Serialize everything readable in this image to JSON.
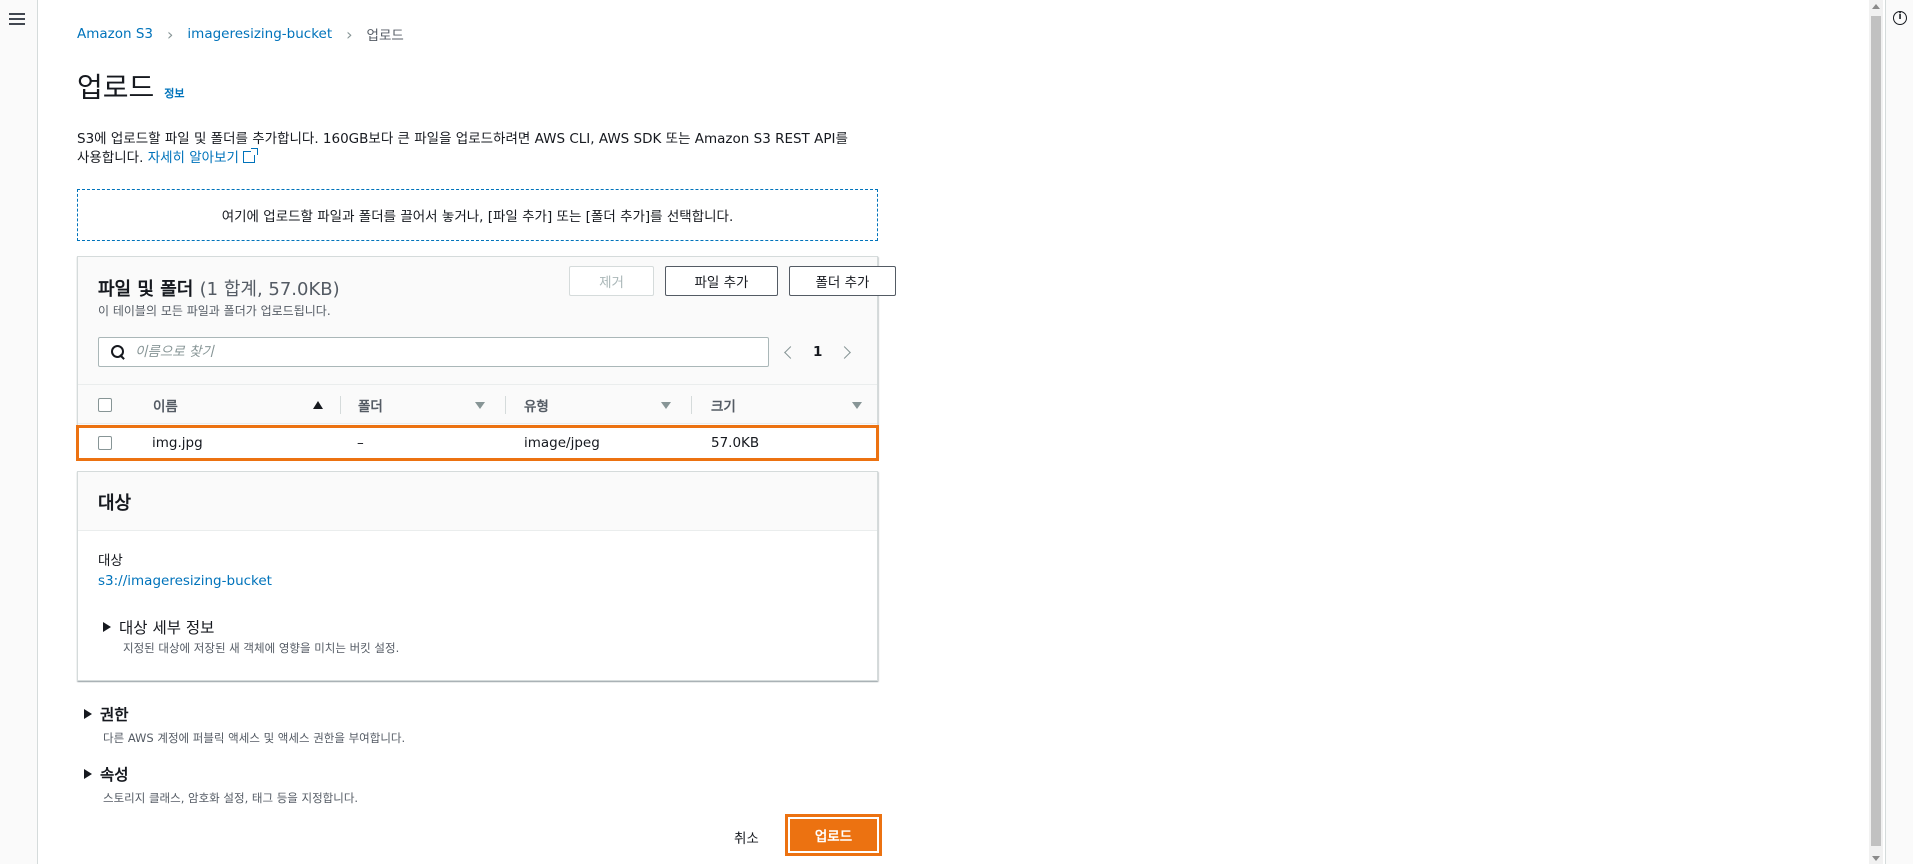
{
  "breadcrumb": {
    "items": [
      "Amazon S3",
      "imageresizing-bucket"
    ],
    "current": "업로드"
  },
  "page": {
    "title": "업로드",
    "info_link": "정보",
    "description_line1": "S3에 업로드할 파일 및 폴더를 추가합니다. 160GB보다 큰 파일을 업로드하려면 AWS CLI, AWS SDK 또는 Amazon S3 REST API를",
    "description_line2": "사용합니다. ",
    "learn_more": "자세히 알아보기"
  },
  "dropzone": {
    "text": "여기에 업로드할 파일과 폴더를 끌어서 놓거나, [파일 추가] 또는 [폴더 추가]를 선택합니다."
  },
  "files": {
    "title": "파일 및 폴더",
    "count": "(1 합계, 57.0KB)",
    "subtitle": "이 테이블의 모든 파일과 폴더가 업로드됩니다.",
    "remove_label": "제거",
    "add_files_label": "파일 추가",
    "add_folder_label": "폴더 추가",
    "search_placeholder": "이름으로 찾기",
    "page": "1",
    "columns": [
      "이름",
      "폴더",
      "유형",
      "크기"
    ],
    "rows": [
      {
        "name": "img.jpg",
        "folder": "–",
        "type": "image/jpeg",
        "size": "57.0KB"
      }
    ]
  },
  "destination": {
    "title": "대상",
    "label": "대상",
    "value": "s3://imageresizing-bucket",
    "details_title": "대상 세부 정보",
    "details_desc": "지정된 대상에 저장된 새 객체에 영향을 미치는 버킷 설정."
  },
  "permissions": {
    "title": "권한",
    "desc": "다른 AWS 계정에 퍼블릭 액세스 및 액세스 권한을 부여합니다."
  },
  "properties": {
    "title": "속성",
    "desc": "스토리지 클래스, 암호화 설정, 태그 등을 지정합니다."
  },
  "footer": {
    "cancel_label": "취소",
    "upload_label": "업로드"
  },
  "colors": {
    "link": "#0073bb",
    "primary": "#ec7211",
    "border": "#d5dbdb"
  }
}
